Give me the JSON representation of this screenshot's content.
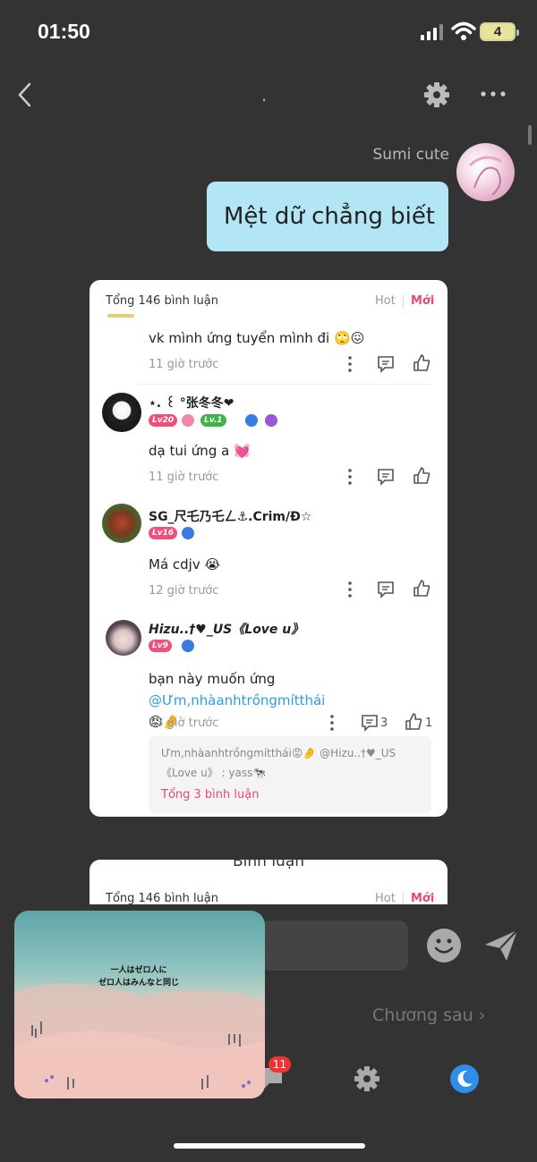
{
  "status": {
    "time": "01:50",
    "battery": "4"
  },
  "nav": {
    "title": "."
  },
  "message": {
    "sender": "Sumi cute",
    "text": "Mệt dữ chẳng biết"
  },
  "card": {
    "total": "Tổng 146 bình luận",
    "hot": "Hot",
    "new": "Mới",
    "comments": [
      {
        "text": "vk mình ứng tuyển mình đi 🙄😖",
        "time": "11 giờ trước"
      },
      {
        "user": "⋆. ꒰ °张冬冬❤︎",
        "badges": [
          "Lv20",
          "Lv.1"
        ],
        "text": "dạ tui ứng a 💓",
        "time": "11 giờ trước"
      },
      {
        "user": "SG_尺乇乃乇ㄥ⚓.Crim/Ð☆",
        "badges": [
          "Lv16"
        ],
        "text": "Má cdjv 😭",
        "time": "12 giờ trước"
      },
      {
        "user": "Hizu..†♥_US《Love u》",
        "badges": [
          "Lv9"
        ],
        "text_prefix": "bạn này muốn ứng ",
        "mention": "@Ưm,nhàanhtrồngmítthái",
        "text_suffix": "😡🤌",
        "time": "13 giờ trước",
        "reply_count": "3",
        "like_count": "1"
      }
    ],
    "reply": {
      "line1": "Ưm,nhàanhtrồngmítthái😡🤌 @Hizu..†♥_US",
      "line2": "《Love u》 : yass🐄",
      "more": "Tổng 3 bình luận"
    }
  },
  "card2": {
    "title": "Bình luận",
    "total": "Tổng 146 bình luận",
    "hot": "Hot",
    "new": "Mới"
  },
  "thumbnail": {
    "text_line1": "一人はゼロ人に",
    "text_line2": "ゼロ人はみんなと同じ"
  },
  "next_chapter": "Chương sau ›",
  "notif_count": "11",
  "colors": {
    "bubble": "#b3e6f5",
    "accent": "#e64977",
    "mention": "#2f9de0",
    "background": "#333333"
  }
}
